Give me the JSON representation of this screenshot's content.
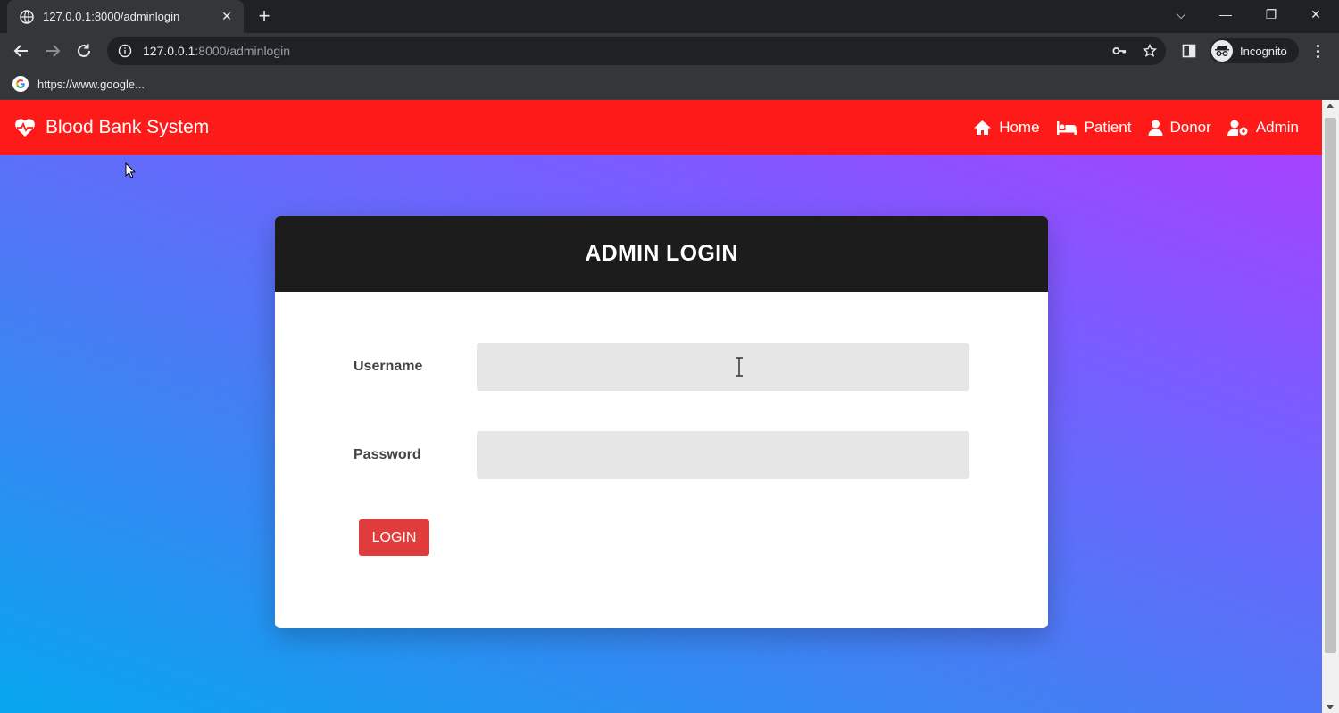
{
  "browser": {
    "tab_title": "127.0.0.1:8000/adminlogin",
    "tab_close": "✕",
    "new_tab": "+",
    "url_host": "127.0.0.1",
    "url_rest": ":8000/adminlogin",
    "profile_label": "Incognito",
    "bookmark_label": "https://www.google...",
    "window_controls": {
      "dropdown": "⌵",
      "minimize": "—",
      "restore": "❐",
      "close": "✕"
    }
  },
  "app": {
    "brand": "Blood Bank System",
    "nav": [
      {
        "label": "Home",
        "icon": "home-icon"
      },
      {
        "label": "Patient",
        "icon": "bed-icon"
      },
      {
        "label": "Donor",
        "icon": "user-icon"
      },
      {
        "label": "Admin",
        "icon": "user-cog-icon"
      }
    ]
  },
  "login": {
    "title": "ADMIN LOGIN",
    "username_label": "Username",
    "username_value": "",
    "password_label": "Password",
    "password_value": "",
    "button_label": "LOGIN"
  },
  "colors": {
    "navbar": "#ff1a1a",
    "card_header": "#1c1c1c",
    "button": "#e03c3c",
    "gradient_top": "#b03cff",
    "gradient_bottom": "#06a6ee"
  }
}
